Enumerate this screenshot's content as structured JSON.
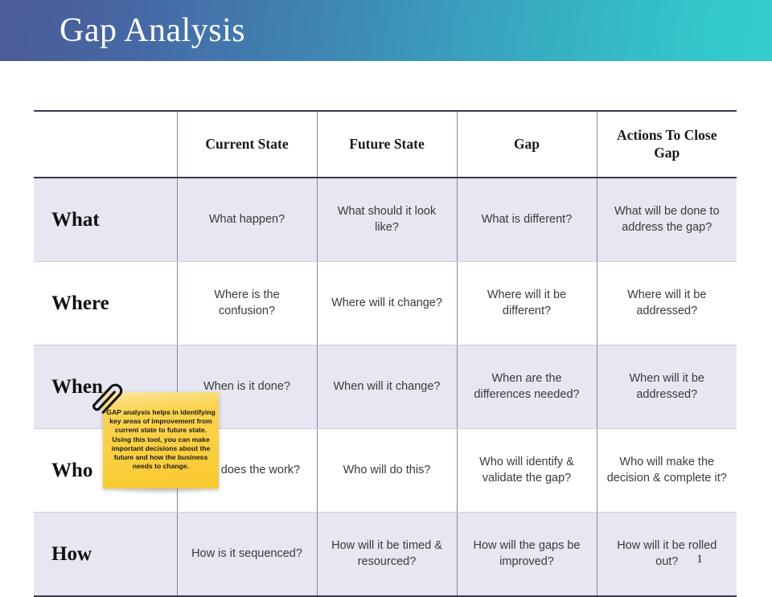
{
  "header": {
    "title": "Gap Analysis",
    "gradient_start": "#4a5d99",
    "gradient_end": "#33cccd"
  },
  "table": {
    "columns": [
      {
        "key": "row_label",
        "header": ""
      },
      {
        "key": "current_state",
        "header": "Current State"
      },
      {
        "key": "future_state",
        "header": "Future State"
      },
      {
        "key": "gap",
        "header": "Gap"
      },
      {
        "key": "actions",
        "header": "Actions To Close Gap"
      }
    ],
    "rows": [
      {
        "label": "What",
        "current_state": "What happen?",
        "future_state": "What should it look like?",
        "gap": "What is different?",
        "actions": "What will be done to address the gap?"
      },
      {
        "label": "Where",
        "current_state": "Where is the confusion?",
        "future_state": "Where will it change?",
        "gap": "Where will it be different?",
        "actions": "Where will it be addressed?"
      },
      {
        "label": "When",
        "current_state": "When is it done?",
        "future_state": "When will it change?",
        "gap": "When are the differences needed?",
        "actions": "When will it be addressed?"
      },
      {
        "label": "Who",
        "current_state": "Who does the work?",
        "future_state": "Who will do this?",
        "gap": "Who will identify & validate the gap?",
        "actions": "Who will make the decision & complete it?"
      },
      {
        "label": "How",
        "current_state": "How is it sequenced?",
        "future_state": "How will it be timed & resourced?",
        "gap": "How will the gaps be improved?",
        "actions": "How will it be rolled out?"
      }
    ],
    "shaded_row_color": "#e6e7f1",
    "plain_row_color": "#ffffff",
    "border_color": "#7e86a8"
  },
  "sticky_note": {
    "text": "GAP analysis helps in identifying key areas of improvement from current state to future state. Using this tool, you can make important decisions about the future and how the business needs to change.",
    "color": "#fbcf41",
    "clip_icon": "paperclip-icon"
  },
  "footer": {
    "page_number": "1"
  }
}
